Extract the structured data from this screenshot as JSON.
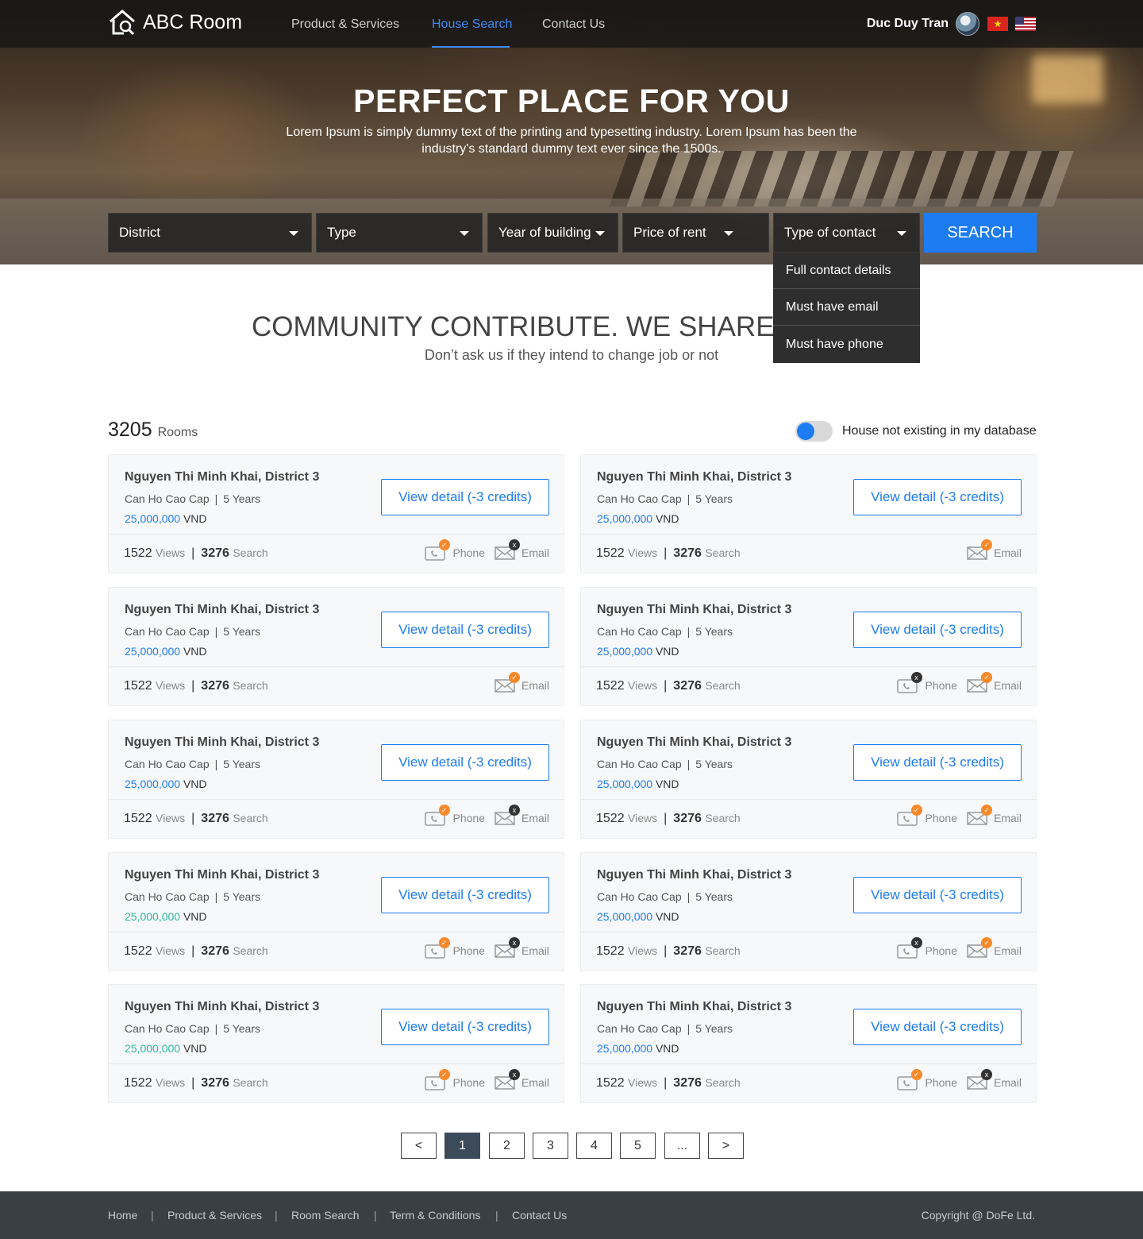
{
  "header": {
    "logo_text": "ABC Room",
    "nav": [
      "Product &  Services",
      "House Search",
      "Contact Us"
    ],
    "active_nav": "House Search",
    "user_name": "Duc Duy Tran",
    "flag_vn_star": "★"
  },
  "hero": {
    "title": "PERFECT PLACE FOR YOU",
    "description": "Lorem Ipsum is simply dummy text of the printing and typesetting industry. Lorem Ipsum has been the industry's standard dummy text ever since the 1500s."
  },
  "search": {
    "filters": [
      "District",
      "Type",
      "Year of building",
      "Price of rent",
      "Type of contact"
    ],
    "button_label": "SEARCH",
    "open_dropdown": {
      "for": "Type of contact",
      "options": [
        "Full contact details",
        "Must have email",
        "Must have phone"
      ]
    }
  },
  "section": {
    "title": "COMMUNITY CONTRIBUTE. WE SHARE. YOU",
    "subtitle": "Don’t ask us if they intend to change job or not"
  },
  "results": {
    "count": "3205",
    "count_label": "Rooms",
    "toggle_label": "House not existing in my database",
    "toggle_on": true
  },
  "card_text": {
    "view_label": "View detail (-3 credits)",
    "views_label": "Views",
    "search_label": "Search",
    "phone_label": "Phone",
    "email_label": "Email",
    "currency": "VND",
    "meta_sep": "|",
    "stats_sep": "|",
    "badge_available": "✓",
    "badge_unavailable": "x"
  },
  "cards": [
    {
      "address": "Nguyen Thi Minh Khai, District 3",
      "type": "Can Ho Cao Cap",
      "age": "5 Years",
      "price": "25,000,000",
      "price_color": "#1e7cf2",
      "views": "1522",
      "searches": "3276",
      "phone": "available",
      "email": "unavailable"
    },
    {
      "address": "Nguyen Thi Minh Khai, District 3",
      "type": "Can Ho Cao Cap",
      "age": "5 Years",
      "price": "25,000,000",
      "price_color": "#1e7cf2",
      "views": "1522",
      "searches": "3276",
      "phone": "none",
      "email": "available"
    },
    {
      "address": "Nguyen Thi Minh Khai, District 3",
      "type": "Can Ho Cao Cap",
      "age": "5 Years",
      "price": "25,000,000",
      "price_color": "#1e7cf2",
      "views": "1522",
      "searches": "3276",
      "phone": "none",
      "email": "available"
    },
    {
      "address": "Nguyen Thi Minh Khai, District 3",
      "type": "Can Ho Cao Cap",
      "age": "5 Years",
      "price": "25,000,000",
      "price_color": "#1e7cf2",
      "views": "1522",
      "searches": "3276",
      "phone": "unavailable",
      "email": "available"
    },
    {
      "address": "Nguyen Thi Minh Khai, District 3",
      "type": "Can Ho Cao Cap",
      "age": "5 Years",
      "price": "25,000,000",
      "price_color": "#1e7cf2",
      "views": "1522",
      "searches": "3276",
      "phone": "available",
      "email": "unavailable"
    },
    {
      "address": "Nguyen Thi Minh Khai, District 3",
      "type": "Can Ho Cao Cap",
      "age": "5 Years",
      "price": "25,000,000",
      "price_color": "#1e7cf2",
      "views": "1522",
      "searches": "3276",
      "phone": "available",
      "email": "available"
    },
    {
      "address": "Nguyen Thi Minh Khai, District 3",
      "type": "Can Ho Cao Cap",
      "age": "5 Years",
      "price": "25,000,000",
      "price_color": "#2bb5a0",
      "views": "1522",
      "searches": "3276",
      "phone": "available",
      "email": "unavailable"
    },
    {
      "address": "Nguyen Thi Minh Khai, District 3",
      "type": "Can Ho Cao Cap",
      "age": "5 Years",
      "price": "25,000,000",
      "price_color": "#1e7cf2",
      "views": "1522",
      "searches": "3276",
      "phone": "unavailable",
      "email": "available"
    },
    {
      "address": "Nguyen Thi Minh Khai, District 3",
      "type": "Can Ho Cao Cap",
      "age": "5 Years",
      "price": "25,000,000",
      "price_color": "#2bb5a0",
      "views": "1522",
      "searches": "3276",
      "phone": "available",
      "email": "unavailable"
    },
    {
      "address": "Nguyen Thi Minh Khai, District 3",
      "type": "Can Ho Cao Cap",
      "age": "5 Years",
      "price": "25,000,000",
      "price_color": "#1e7cf2",
      "views": "1522",
      "searches": "3276",
      "phone": "available",
      "email": "unavailable"
    }
  ],
  "pagination": {
    "items": [
      "<",
      "1",
      "2",
      "3",
      "4",
      "5",
      "...",
      ">"
    ],
    "current": "1"
  },
  "footer": {
    "links": [
      "Home",
      "Product & Services",
      "Room  Search",
      "Term & Conditions",
      "Contact Us"
    ],
    "separator": "|",
    "copyright": "Copyright @ DoFe Ltd."
  },
  "colors": {
    "accent": "#1e7cf2",
    "badge_available": "#f7892b",
    "badge_unavailable": "#333333",
    "footer_bg": "#3a3f44"
  }
}
